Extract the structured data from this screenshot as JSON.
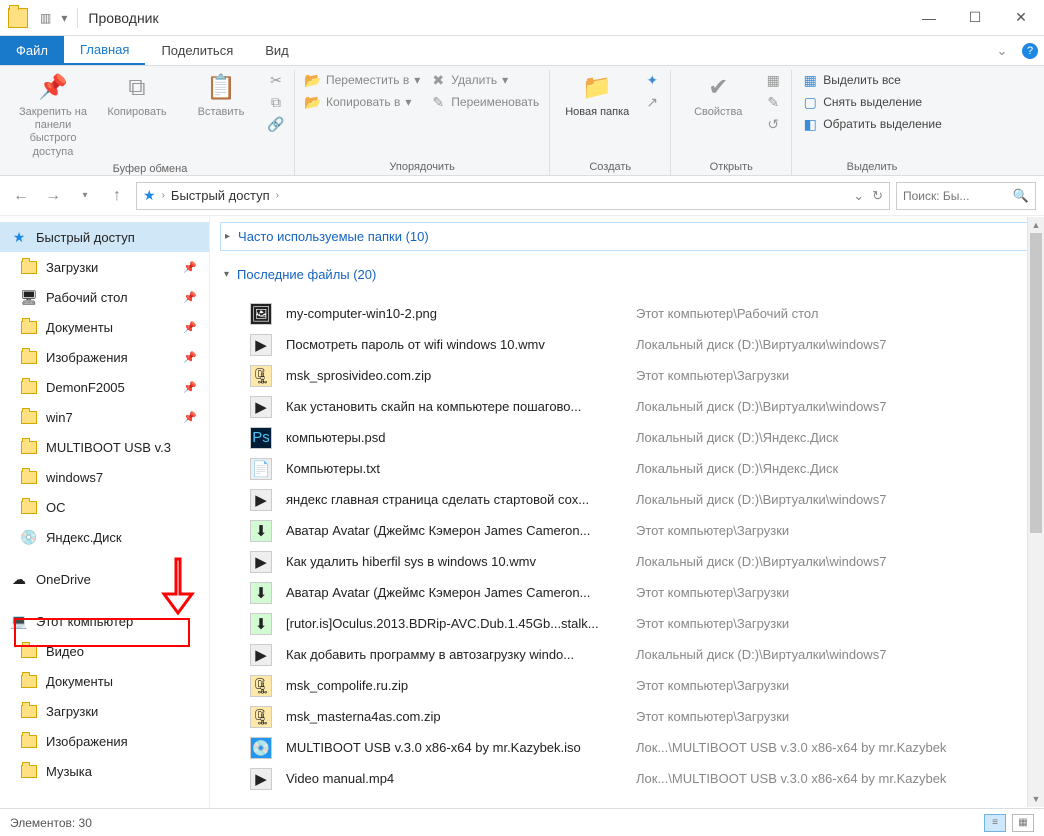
{
  "window": {
    "title": "Проводник"
  },
  "menu": {
    "file": "Файл",
    "tabs": [
      "Главная",
      "Поделиться",
      "Вид"
    ]
  },
  "ribbon": {
    "group1_label": "Буфер обмена",
    "pin": "Закрепить на панели быстрого доступа",
    "copy": "Копировать",
    "paste": "Вставить",
    "group2_label": "Упорядочить",
    "move_to": "Переместить в",
    "copy_to": "Копировать в",
    "delete": "Удалить",
    "rename": "Переименовать",
    "group3_label": "Создать",
    "new_folder": "Новая папка",
    "group4_label": "Открыть",
    "properties": "Свойства",
    "group5_label": "Выделить",
    "select_all": "Выделить все",
    "select_none": "Снять выделение",
    "invert_sel": "Обратить выделение"
  },
  "address": {
    "crumb": "Быстрый доступ"
  },
  "search": {
    "placeholder": "Поиск: Бы..."
  },
  "groups": {
    "frequent": "Часто используемые папки (10)",
    "recent": "Последние файлы (20)"
  },
  "sidebar": [
    {
      "label": "Быстрый доступ",
      "icon": "star",
      "active": true,
      "top": true
    },
    {
      "label": "Загрузки",
      "icon": "folder",
      "pin": true
    },
    {
      "label": "Рабочий стол",
      "icon": "desktop",
      "pin": true
    },
    {
      "label": "Документы",
      "icon": "folder",
      "pin": true
    },
    {
      "label": "Изображения",
      "icon": "folder",
      "pin": true
    },
    {
      "label": "DemonF2005",
      "icon": "folder",
      "pin": true
    },
    {
      "label": "win7",
      "icon": "folder",
      "pin": true
    },
    {
      "label": "MULTIBOOT USB v.3",
      "icon": "folder"
    },
    {
      "label": "windows7",
      "icon": "folder"
    },
    {
      "label": "ОС",
      "icon": "folder"
    },
    {
      "label": "Яндекс.Диск",
      "icon": "disk"
    },
    {
      "label": "OneDrive",
      "icon": "cloud",
      "top": true,
      "pad": true
    },
    {
      "label": "Этот компьютер",
      "icon": "pc",
      "top": true,
      "pad": true
    },
    {
      "label": "Видео",
      "icon": "folder"
    },
    {
      "label": "Документы",
      "icon": "folder"
    },
    {
      "label": "Загрузки",
      "icon": "folder"
    },
    {
      "label": "Изображения",
      "icon": "folder"
    },
    {
      "label": "Музыка",
      "icon": "folder"
    }
  ],
  "files": [
    {
      "name": "my-computer-win10-2.png",
      "loc": "Этот компьютер\\Рабочий стол",
      "ico": "img"
    },
    {
      "name": "Посмотреть пароль от wifi windows 10.wmv",
      "loc": "Локальный диск (D:)\\Виртуалки\\windows7",
      "ico": "vid"
    },
    {
      "name": "msk_sprosivideo.com.zip",
      "loc": "Этот компьютер\\Загрузки",
      "ico": "zip"
    },
    {
      "name": "Как установить скайп на компьютере пошагово...",
      "loc": "Локальный диск (D:)\\Виртуалки\\windows7",
      "ico": "vid"
    },
    {
      "name": "компьютеры.psd",
      "loc": "Локальный диск (D:)\\Яндекс.Диск",
      "ico": "psd"
    },
    {
      "name": "Компьютеры.txt",
      "loc": "Локальный диск (D:)\\Яндекс.Диск",
      "ico": "txt"
    },
    {
      "name": "яндекс главная страница сделать стартовой сох...",
      "loc": "Локальный диск (D:)\\Виртуалки\\windows7",
      "ico": "vid"
    },
    {
      "name": "Аватар Avatar (Джеймс Кэмерон James Cameron...",
      "loc": "Этот компьютер\\Загрузки",
      "ico": "tor"
    },
    {
      "name": "Как удалить hiberfil sys в windows 10.wmv",
      "loc": "Локальный диск (D:)\\Виртуалки\\windows7",
      "ico": "vid"
    },
    {
      "name": "Аватар Avatar (Джеймс Кэмерон James Cameron...",
      "loc": "Этот компьютер\\Загрузки",
      "ico": "tor"
    },
    {
      "name": "[rutor.is]Oculus.2013.BDRip-AVC.Dub.1.45Gb...stalk...",
      "loc": "Этот компьютер\\Загрузки",
      "ico": "tor"
    },
    {
      "name": "Как добавить программу в автозагрузку windo...",
      "loc": "Локальный диск (D:)\\Виртуалки\\windows7",
      "ico": "vid"
    },
    {
      "name": "msk_compolife.ru.zip",
      "loc": "Этот компьютер\\Загрузки",
      "ico": "zip"
    },
    {
      "name": "msk_masterna4as.com.zip",
      "loc": "Этот компьютер\\Загрузки",
      "ico": "zip"
    },
    {
      "name": "MULTIBOOT USB v.3.0 x86-x64 by mr.Kazybek.iso",
      "loc": "Лок...\\MULTIBOOT USB v.3.0 x86-x64 by mr.Kazybek",
      "ico": "iso"
    },
    {
      "name": "Video manual.mp4",
      "loc": "Лок...\\MULTIBOOT USB v.3.0 x86-x64 by mr.Kazybek",
      "ico": "vid"
    }
  ],
  "status": {
    "items": "Элементов: 30"
  }
}
